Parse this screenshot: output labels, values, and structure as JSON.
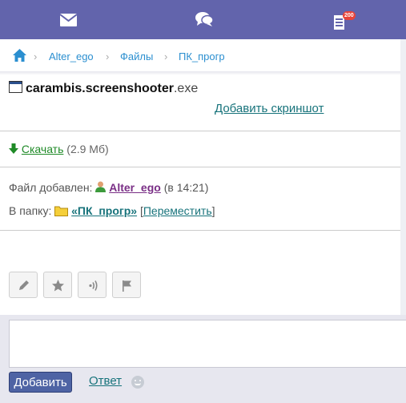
{
  "topbar": {
    "mail_icon": "envelope-icon",
    "chat_icon": "speech-bubbles-icon",
    "notify_icon": "notes-icon",
    "notify_badge": "200"
  },
  "breadcrumb": {
    "home_icon": "house-icon",
    "items": [
      "Alter_ego",
      "Файлы",
      "ПК_прогр"
    ]
  },
  "file": {
    "name_bold": "carambis.screenshooter",
    "ext": ".exe",
    "add_screenshot": "Добавить скриншот",
    "download_label": "Скачать",
    "size": "(2.9 Мб)"
  },
  "info": {
    "added_label": "Файл добавлен:",
    "author": "Alter_ego",
    "time": "(в 14:21)",
    "folder_label": "В папку:",
    "folder_name": "«ПК_прогр»",
    "move_label": "Переместить"
  },
  "toolbar": {
    "buttons": [
      "pencil-icon",
      "star-icon",
      "broadcast-icon",
      "flag-icon"
    ]
  },
  "composer": {
    "message_value": "",
    "add_button": "Добавить",
    "reply_link": "Ответ"
  },
  "colors": {
    "topbar": "#6264ac",
    "link": "#17737b",
    "download": "#1f8a27",
    "author": "#7a2f86",
    "button": "#4e63a4"
  }
}
